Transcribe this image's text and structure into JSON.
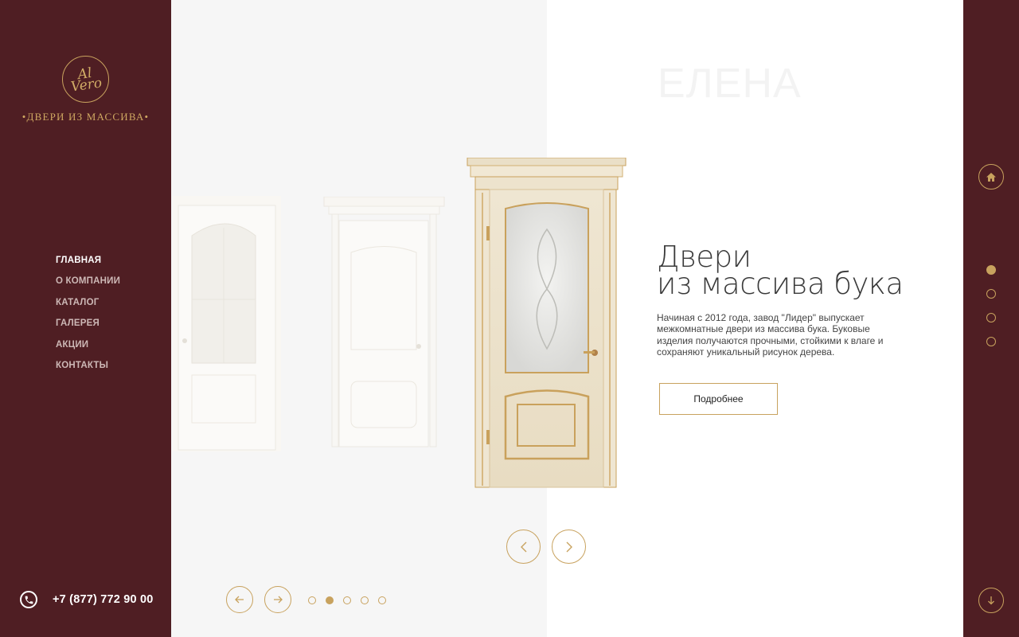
{
  "brand": {
    "emblem_text": "Al Vero",
    "tagline": "•ДВЕРИ ИЗ МАССИВА•",
    "accent_color": "#c8a25e",
    "sidebar_color": "#4f1e23"
  },
  "nav": {
    "items": [
      {
        "label": "ГЛАВНАЯ",
        "active": true
      },
      {
        "label": "О КОМПАНИИ",
        "active": false
      },
      {
        "label": "КАТАЛОГ",
        "active": false
      },
      {
        "label": "ГАЛЕРЕЯ",
        "active": false
      },
      {
        "label": "АКЦИИ",
        "active": false
      },
      {
        "label": "КОНТАКТЫ",
        "active": false
      }
    ]
  },
  "contact": {
    "phone": "+7 (877) 772 90 00",
    "icon": "phone-icon"
  },
  "slider": {
    "product_name": "ЕЛЕНА",
    "headline_line1": "Двери",
    "headline_line2": "из массива бука",
    "description": "Начиная с 2012 года, завод \"Лидер\" выпускает межкомнатные двери из массива бука. Буковые изделия получаются прочными, стойкими к влаге и сохраняют уникальный рисунок дерева.",
    "more_label": "Подробнее",
    "door_prev_icon": "chevron-left-icon",
    "door_next_icon": "chevron-right-icon"
  },
  "bottom_slider": {
    "prev_icon": "arrow-left-icon",
    "next_icon": "arrow-right-icon",
    "dots": 5,
    "active_dot": 2
  },
  "section_nav": {
    "home_icon": "home-icon",
    "down_icon": "arrow-down-icon",
    "dots": 4,
    "active_dot": 1
  }
}
